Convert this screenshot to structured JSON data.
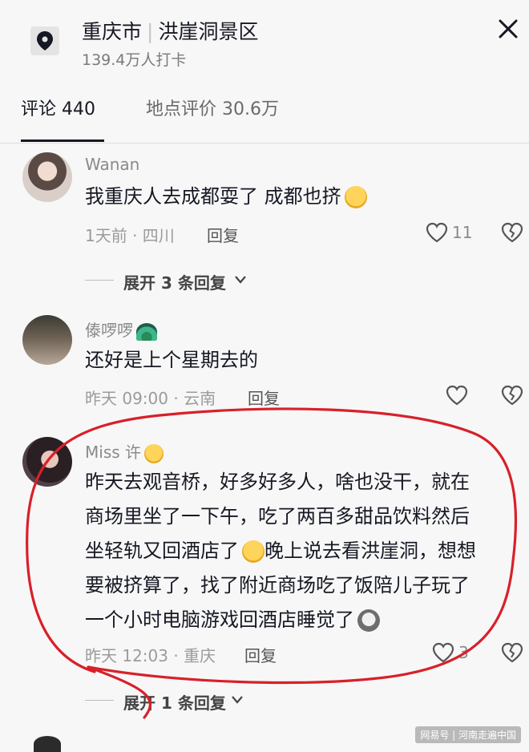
{
  "header": {
    "city": "重庆市",
    "separator": "|",
    "place": "洪崖洞景区",
    "checkins": "139.4万人打卡",
    "icons": {
      "location": "location-pin-icon",
      "close": "close-icon"
    }
  },
  "tabs": [
    {
      "label": "评论 440",
      "active": true
    },
    {
      "label": "地点评价 30.6万",
      "active": false
    }
  ],
  "comments": [
    {
      "username": "Wanan",
      "text": "我重庆人去成都耍了 成都也挤",
      "emoji": "pleading-face",
      "meta": "1天前 · 四川",
      "reply_label": "回复",
      "likes": "11",
      "expand_label": "展开 3 条回复"
    },
    {
      "username": "傣啰啰",
      "username_emoji": "peacock",
      "text": "还好是上个星期去的",
      "meta": "昨天 09:00 · 云南",
      "reply_label": "回复",
      "likes": ""
    },
    {
      "username": "Miss 许",
      "username_emoji": "shushing-face",
      "lines": [
        "昨天去观音桥，好多好多人，啥也没干，就在",
        "商场里坐了一下午，吃了两百多甜品饮料然后",
        "坐轻轨又回酒店了",
        "晚上说去看洪崖洞，想想",
        "要被挤算了，找了附近商场吃了饭陪儿子玩了",
        "一个小时电脑游戏回酒店睡觉了"
      ],
      "meta": "昨天 12:03 · 重庆",
      "reply_label": "回复",
      "likes": "3",
      "expand_label": "展开 1 条回复"
    }
  ],
  "watermark": "网易号 | 河南走遍中国",
  "colors": {
    "background": "#f7f7f7",
    "text": "#161823",
    "muted": "#9b9b9b",
    "annotation": "#d8202a"
  }
}
